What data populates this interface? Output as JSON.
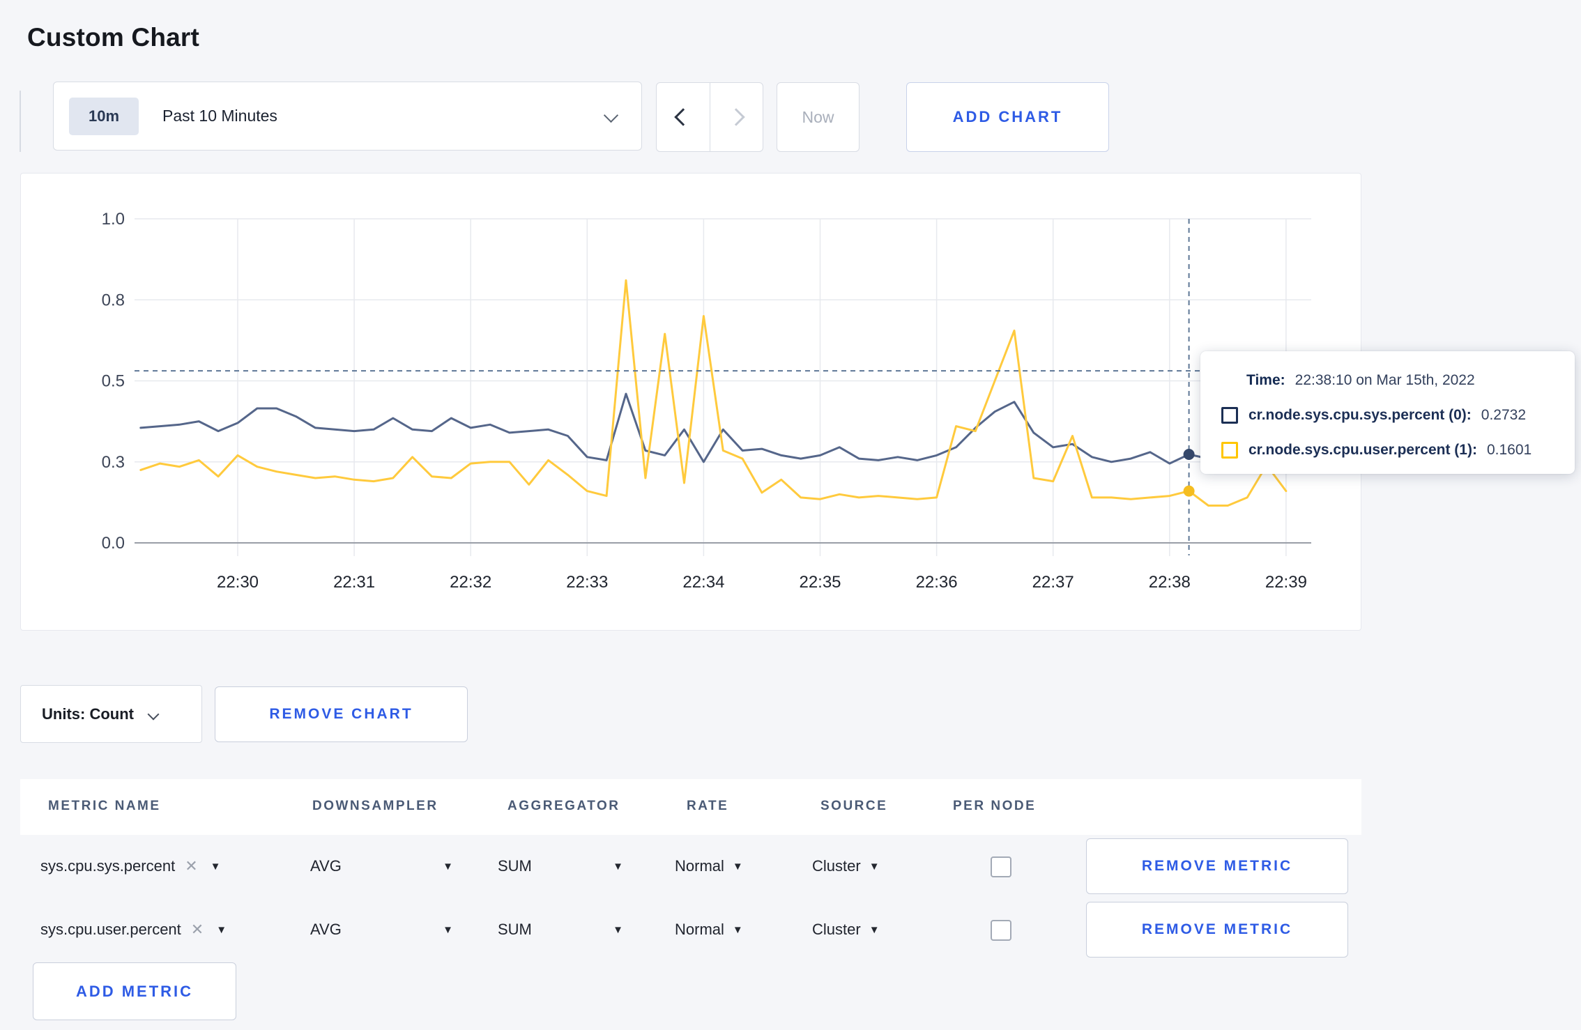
{
  "page": {
    "title": "Custom Chart"
  },
  "toolbar": {
    "time_range": {
      "badge": "10m",
      "label": "Past 10 Minutes"
    },
    "now_label": "Now",
    "add_chart_label": "ADD CHART"
  },
  "tooltip": {
    "time_label": "Time:",
    "time_value": "22:38:10 on Mar 15th, 2022",
    "series": [
      {
        "name": "cr.node.sys.cpu.sys.percent (0):",
        "value": "0.2732",
        "color": "#1b2f54"
      },
      {
        "name": "cr.node.sys.cpu.user.percent (1):",
        "value": "0.1601",
        "color": "#ffc600"
      }
    ]
  },
  "chart_controls": {
    "units_label": "Units: Count",
    "remove_chart_label": "REMOVE CHART"
  },
  "metrics_table": {
    "headers": [
      "METRIC NAME",
      "DOWNSAMPLER",
      "AGGREGATOR",
      "RATE",
      "SOURCE",
      "PER NODE"
    ],
    "rows": [
      {
        "metric_name": "sys.cpu.sys.percent",
        "downsampler": "AVG",
        "aggregator": "SUM",
        "rate": "Normal",
        "source": "Cluster",
        "per_node_checked": false,
        "remove_label": "REMOVE METRIC"
      },
      {
        "metric_name": "sys.cpu.user.percent",
        "downsampler": "AVG",
        "aggregator": "SUM",
        "rate": "Normal",
        "source": "Cluster",
        "per_node_checked": false,
        "remove_label": "REMOVE METRIC"
      }
    ],
    "add_metric_label": "ADD METRIC"
  },
  "icons": {
    "select_triangle": "▼",
    "clear": "✕"
  },
  "chart_data": {
    "type": "line",
    "title": "",
    "ylim": [
      0,
      1
    ],
    "grid": true,
    "legend_position": "tooltip-only",
    "x_start": "22:29:10",
    "x_step_seconds": 10,
    "x_ticks": [
      "22:30",
      "22:31",
      "22:32",
      "22:33",
      "22:34",
      "22:35",
      "22:36",
      "22:37",
      "22:38",
      "22:39"
    ],
    "y_ticks": [
      {
        "value": 0,
        "label": "0.0"
      },
      {
        "value": 0.25,
        "label": "0.3"
      },
      {
        "value": 0.5,
        "label": "0.5"
      },
      {
        "value": 0.75,
        "label": "0.8"
      },
      {
        "value": 1.0,
        "label": "1.0"
      }
    ],
    "series": [
      {
        "name": "cr.node.sys.cpu.sys.percent",
        "color": "#55668a",
        "dot_color": "#35486b",
        "values": [
          0.355,
          0.36,
          0.365,
          0.375,
          0.345,
          0.37,
          0.415,
          0.415,
          0.39,
          0.355,
          0.35,
          0.345,
          0.35,
          0.385,
          0.35,
          0.345,
          0.385,
          0.355,
          0.365,
          0.34,
          0.345,
          0.35,
          0.33,
          0.265,
          0.255,
          0.46,
          0.285,
          0.27,
          0.35,
          0.25,
          0.35,
          0.285,
          0.29,
          0.27,
          0.26,
          0.27,
          0.295,
          0.26,
          0.255,
          0.265,
          0.255,
          0.27,
          0.295,
          0.355,
          0.405,
          0.435,
          0.34,
          0.295,
          0.305,
          0.265,
          0.25,
          0.26,
          0.28,
          0.245,
          0.2732,
          0.26,
          0.26,
          0.265,
          0.27,
          0.27
        ]
      },
      {
        "name": "cr.node.sys.cpu.user.percent",
        "color": "#ffca3d",
        "dot_color": "#f5bd20",
        "values": [
          0.225,
          0.245,
          0.235,
          0.255,
          0.205,
          0.27,
          0.235,
          0.22,
          0.21,
          0.2,
          0.205,
          0.195,
          0.19,
          0.2,
          0.265,
          0.205,
          0.2,
          0.245,
          0.25,
          0.25,
          0.18,
          0.255,
          0.21,
          0.16,
          0.145,
          0.81,
          0.2,
          0.645,
          0.185,
          0.7,
          0.285,
          0.26,
          0.155,
          0.195,
          0.14,
          0.135,
          0.15,
          0.14,
          0.145,
          0.14,
          0.135,
          0.14,
          0.36,
          0.345,
          0.5,
          0.655,
          0.2,
          0.19,
          0.33,
          0.14,
          0.14,
          0.135,
          0.14,
          0.145,
          0.1601,
          0.115,
          0.115,
          0.14,
          0.24,
          0.16
        ]
      }
    ],
    "crosshair": {
      "time": "22:38:10",
      "horizontal_value": 0.531,
      "points": [
        {
          "series": 0,
          "value": 0.2732
        },
        {
          "series": 1,
          "value": 0.1601
        }
      ]
    }
  }
}
